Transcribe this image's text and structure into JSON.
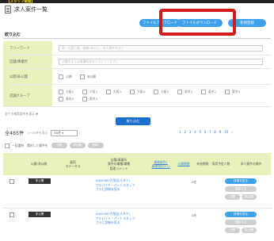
{
  "header": {
    "strip_text": "【スタッフ検索】",
    "title": "求人案件一覧",
    "buttons": [
      "ファイルアップロード",
      "ファイルダウンロード",
      "新規登録"
    ]
  },
  "search": {
    "section_label": "絞り込む",
    "freeword": {
      "label": "フリーワード",
      "placeholder": "例：応募可能、経験1年以上、求人案件名など"
    },
    "location": {
      "label": "店舗/事業所",
      "placeholder": "店舗名または事業所名を入力してください"
    },
    "public_status": {
      "label": "公開/非公開",
      "options": [
        "公開",
        "非公開"
      ]
    },
    "store_group": {
      "label": "店舗グループ",
      "options": [
        "大阪1",
        "大阪2",
        "大阪3",
        "大阪4",
        "大阪5",
        "東京1",
        "東京2",
        "東京3",
        "東京4",
        "東京5"
      ]
    },
    "details_link": "全ての検索条件を表示 ▼",
    "submit_label": "絞り込む"
  },
  "results": {
    "count_label": "全465件",
    "range_label": "1〜50件を表示",
    "per_page": "50件",
    "pages": [
      "1",
      "2",
      "3",
      "4",
      "5",
      "6",
      "7",
      "8",
      "9",
      "10",
      "›"
    ]
  },
  "bulk": {
    "label": "一括選択　選択した案件を",
    "actions": [
      "公開",
      "非公開",
      "削除"
    ]
  },
  "table": {
    "headers": [
      "公開/非公開",
      "雇用\nステータス",
      "店舗/事業所\n案件の職種/職種\n管理コメント",
      "資格項目1\n資格項目2(1)",
      "公開期限",
      "有効期限",
      "採用予定人数",
      "求人案件の操作"
    ],
    "rows": [
      {
        "status": "非公開",
        "job": "KANOMEI大阪店(ＡＢＣ)\nアルバイト・パートスタッフ\nさらに詳細を見る",
        "count": "0名",
        "actions": [
          "詳細を見る",
          "複製する",
          "公開",
          "非公開"
        ]
      },
      {
        "status": "非公開",
        "job": "KANOMEI大阪店(ＡＢＣ)\nアルバイト・パートスタッフ\nさらに詳細を見る",
        "count": "0名",
        "actions": [
          "詳細を見る",
          "複製する",
          "公開",
          "非公開"
        ]
      }
    ]
  },
  "colors": {
    "accent": "#3ea1ea",
    "primary_button": "#1a6fd0",
    "highlight": "#d11b1b",
    "label_bg": "#e8f0bb"
  }
}
